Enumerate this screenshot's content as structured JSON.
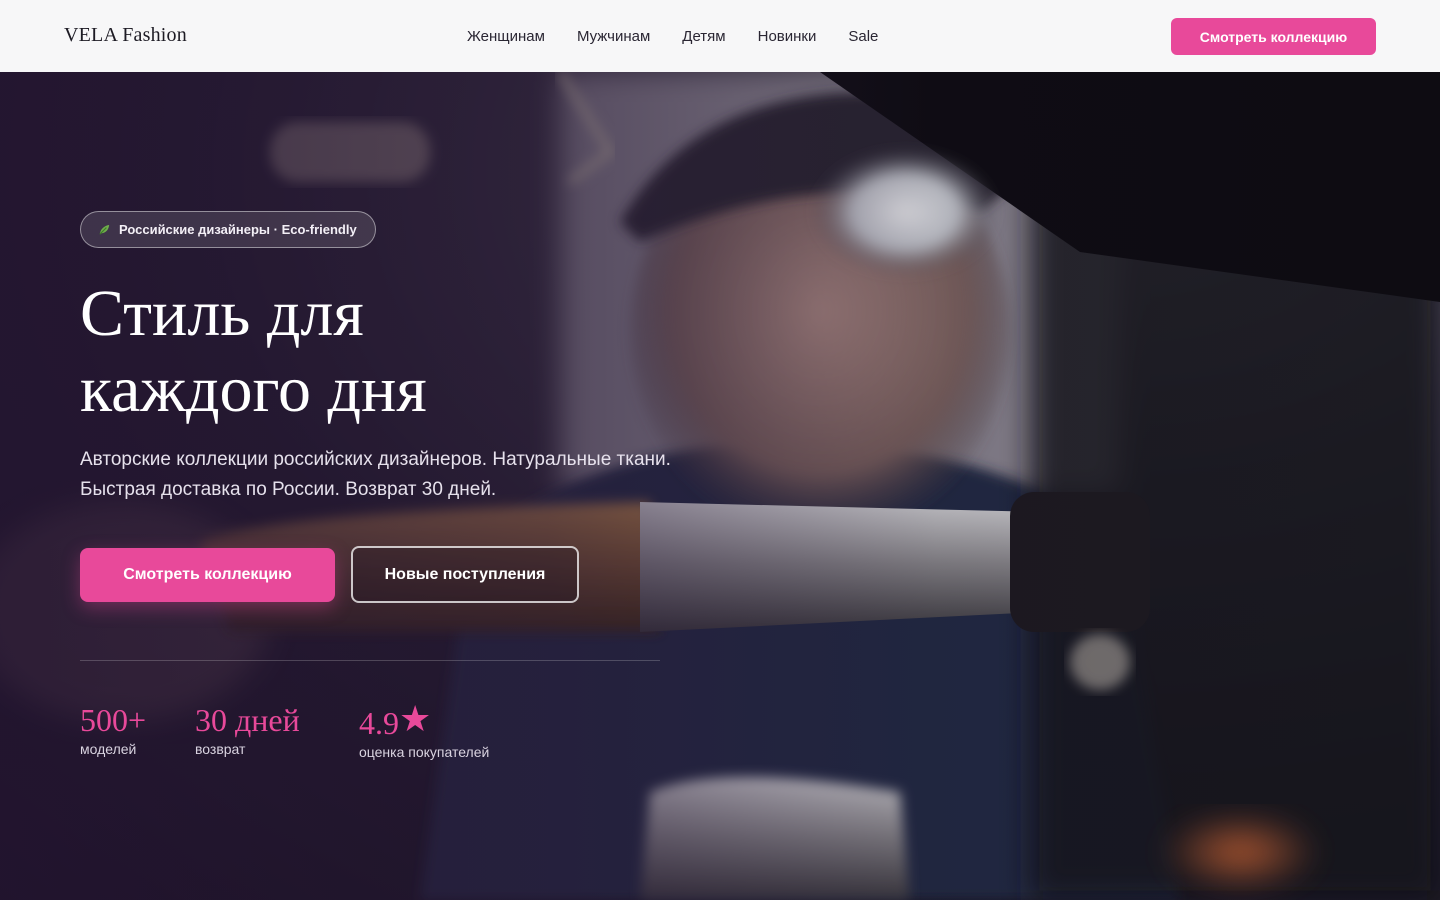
{
  "header": {
    "logo": "VELA Fashion",
    "nav": [
      "Женщинам",
      "Мужчинам",
      "Детям",
      "Новинки",
      "Sale"
    ],
    "cta_label": "Смотреть коллекцию"
  },
  "hero": {
    "badge_text": "Российские дизайнеры · Eco-friendly",
    "badge_icon": "leaf-icon",
    "title_line1": "Стиль для",
    "title_line2": "каждого дня",
    "description": "Авторские коллекции российских дизайнеров. Натуральные ткани. Быстрая доставка по России. Возврат 30 дней.",
    "primary_button": "Смотреть коллекцию",
    "secondary_button": "Новые поступления",
    "stats": [
      {
        "value": "500+",
        "label": "моделей"
      },
      {
        "value": "30 дней",
        "label": "возврат"
      },
      {
        "value": "4.9",
        "suffix": "★",
        "label": "оценка покупателей"
      }
    ]
  },
  "colors": {
    "accent": "#e8499a",
    "header_bg": "#ffffff",
    "text_dark": "#1d1b24"
  }
}
